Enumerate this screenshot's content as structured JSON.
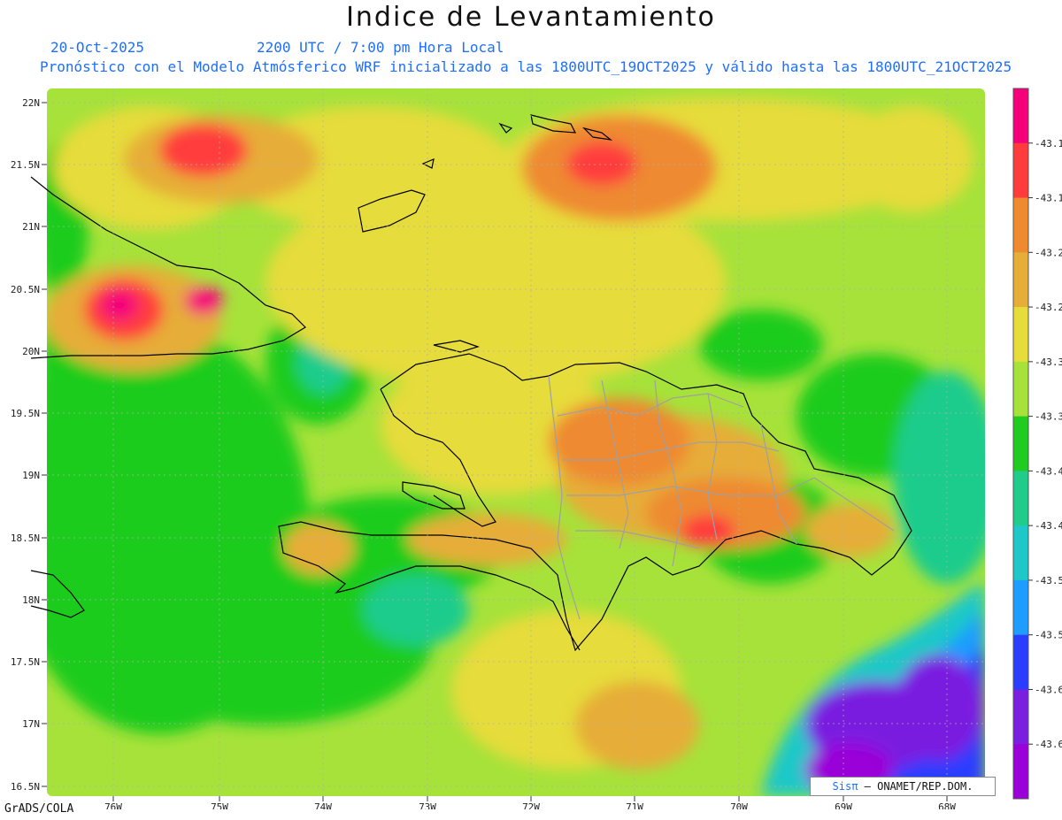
{
  "header": {
    "title": "Indice de Levantamiento",
    "date": "20-Oct-2025",
    "time": "2200 UTC / 7:00 pm Hora Local",
    "subtitle": "Pronóstico con el Modelo Atmósferico WRF inicializado a las 1800UTC_19OCT2025 y válido hasta las  1800UTC_21OCT2025"
  },
  "map": {
    "lat_labels": [
      "22N",
      "21.5N",
      "21N",
      "20.5N",
      "20N",
      "19.5N",
      "19N",
      "18.5N",
      "18N",
      "17.5N",
      "17N",
      "16.5N"
    ],
    "lon_labels": [
      "76W",
      "75W",
      "74W",
      "73W",
      "72W",
      "71W",
      "70W",
      "69W",
      "68W"
    ],
    "lat_range": [
      16.5,
      22
    ],
    "lon_range": [
      -76,
      -68
    ],
    "coastline_color": "#000000",
    "province_border_color": "#a0a0a0"
  },
  "colorbar": {
    "labels": [
      "-43.1",
      "-43.1",
      "-43.2",
      "-43.2",
      "-43.3",
      "-43.3",
      "-43.4",
      "-43.4",
      "-43.5",
      "-43.5",
      "-43.6",
      "-43.6"
    ],
    "colors": [
      "#f5007a",
      "#ff3c3c",
      "#ee8a30",
      "#e6ad38",
      "#e6dc3a",
      "#a6e23a",
      "#1fcc1f",
      "#1fcc8c",
      "#1fc8c8",
      "#1e9cff",
      "#2a3cff",
      "#7a1fe0",
      "#9a00d8"
    ]
  },
  "footer": {
    "credit_brand": "Sisπ",
    "credit_text": " – ONAMET/REP.DOM.",
    "software": "GrADS/COLA"
  }
}
